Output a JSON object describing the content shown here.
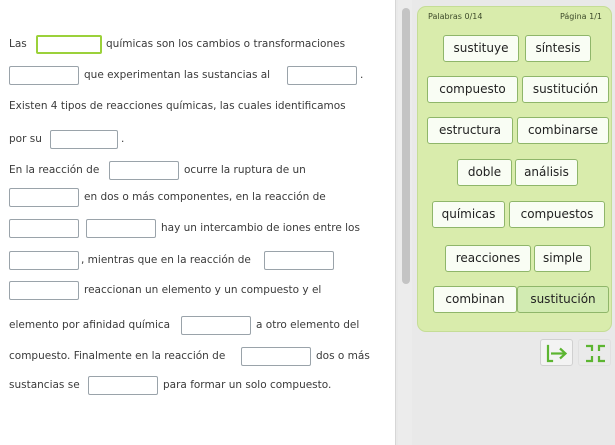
{
  "sentences": {
    "l1a": "Las",
    "l1b": "químicas son los cambios o transformaciones",
    "l2a": "que experimentan las sustancias al",
    "l2b": ".",
    "l3": "Existen 4 tipos de reacciones químicas, las cuales identificamos",
    "l4a": "por su",
    "l4b": ".",
    "l5a": "En la reacción de",
    "l5b": "ocurre la ruptura de un",
    "l6": "en dos o más componentes, en la reacción de",
    "l7": "hay un intercambio de iones entre los",
    "l8a": ", mientras que en la reacción de",
    "l9": "reaccionan un elemento y un compuesto y el",
    "l10a": "elemento por afinidad química",
    "l10b": "a otro elemento del",
    "l11a": "compuesto. Finalmente en la reacción de",
    "l11b": "dos o más",
    "l12a": "sustancias se",
    "l12b": "para formar un solo compuesto."
  },
  "panel": {
    "word_count": "Palabras 0/14",
    "page": "Página 1/1"
  },
  "words": [
    "sustituye",
    "síntesis",
    "compuesto",
    "sustitución",
    "estructura",
    "combinarse",
    "doble",
    "análisis",
    "químicas",
    "compuestos",
    "reacciones",
    "simple",
    "combinan",
    "sustitución"
  ],
  "colors": {
    "panel_bg": "#d9ecac",
    "accent": "#9bd13a",
    "button_arrow": "#5cb531"
  },
  "icons": {
    "submit": "arrow-right-icon",
    "fullscreen": "fullscreen-icon"
  }
}
